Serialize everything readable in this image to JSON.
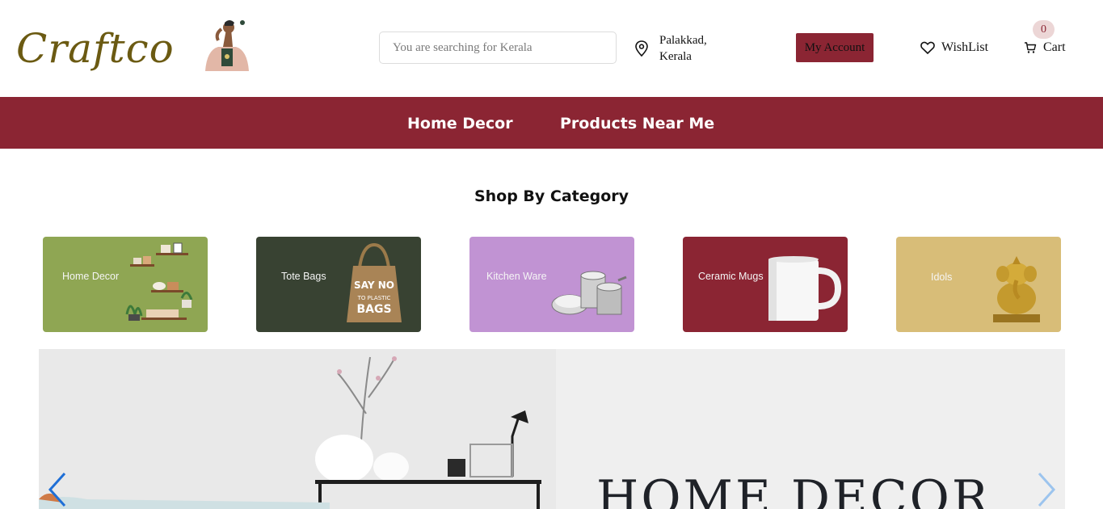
{
  "brand": {
    "logo_text": "Craftco",
    "logo_icon": "craftsperson-figure-icon"
  },
  "search": {
    "placeholder": "You are searching for Kerala",
    "value": ""
  },
  "location": {
    "line1": "Palakkad,",
    "line2": "Kerala",
    "icon": "location-pin-icon"
  },
  "header": {
    "account_label": "My Account",
    "wishlist_label": "WishList",
    "wishlist_icon": "heart-icon",
    "cart_label": "Cart",
    "cart_icon": "cart-icon",
    "cart_count": "0"
  },
  "nav": {
    "items": [
      {
        "label": "Home Decor"
      },
      {
        "label": "Products Near Me"
      }
    ]
  },
  "categories": {
    "title": "Shop By Category",
    "items": [
      {
        "label": "Home Decor",
        "color": "#8fa653",
        "icon": "shelves-decor-icon"
      },
      {
        "label": "Tote Bags",
        "color": "#384232",
        "icon": "tote-bag-icon"
      },
      {
        "label": "Kitchen Ware",
        "color": "#c193d3",
        "icon": "steel-tiffin-icon"
      },
      {
        "label": "Ceramic Mugs",
        "color": "#8b2533",
        "icon": "mug-icon"
      },
      {
        "label": "Idols",
        "color": "#d8bd78",
        "icon": "ganesha-idol-icon"
      }
    ]
  },
  "banner": {
    "headline": "HOME DECOR",
    "prev_icon": "chevron-left-icon",
    "next_icon": "chevron-right-icon"
  },
  "colors": {
    "primary": "#8b2533",
    "logo": "#6b5a12",
    "banner_bg": "#efefef"
  }
}
